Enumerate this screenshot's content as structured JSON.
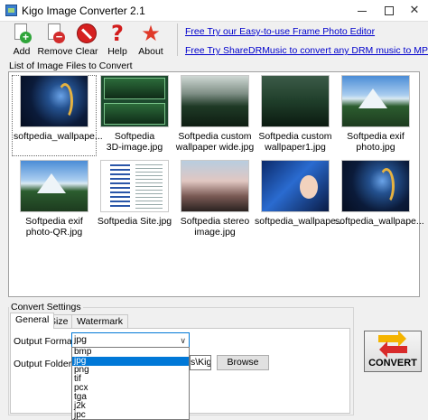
{
  "window": {
    "title": "Kigo Image Converter 2.1",
    "min": "",
    "max": "",
    "close": "✕"
  },
  "toolbar": {
    "add": "Add",
    "remove": "Remove",
    "clear": "Clear",
    "help": "Help",
    "about": "About",
    "help_glyph": "?",
    "about_glyph": "★"
  },
  "promos": {
    "link1": "Free Try our Easy-to-use Frame Photo Editor",
    "link2": "Free Try ShareDRMusic to convert any DRM music to MP3"
  },
  "image_list": {
    "label": "List of Image Files to Convert",
    "items": [
      {
        "caption": "softpedia_wallpape...",
        "icon": "dark-swirl"
      },
      {
        "caption": "Softpedia\n3D-image.jpg",
        "icon": "split-3d"
      },
      {
        "caption": "Softpedia custom\nwallpaper wide.jpg",
        "icon": "forest-fog"
      },
      {
        "caption": "Softpedia custom\nwallpaper1.jpg",
        "icon": "forest-dark"
      },
      {
        "caption": "Softpedia exif\nphoto.jpg",
        "icon": "mountain"
      },
      {
        "caption": "Softpedia exif\nphoto-QR.jpg",
        "icon": "mountain"
      },
      {
        "caption": "Softpedia Site.jpg",
        "icon": "website"
      },
      {
        "caption": "Softpedia stereo\nimage.jpg",
        "icon": "stereo"
      },
      {
        "caption": "softpedia_wallpape...",
        "icon": "girl"
      },
      {
        "caption": "softpedia_wallpape...",
        "icon": "dark-swirl"
      }
    ]
  },
  "settings": {
    "group_label": "Convert Settings",
    "tabs": [
      "General",
      "Size",
      "Watermark"
    ],
    "output_format_label": "Output Format",
    "output_format_value": "jpg",
    "output_folder_label": "Output Folder",
    "output_folder_value": "s\\Kig",
    "browse": "Browse",
    "format_options": [
      "bmp",
      "jpg",
      "png",
      "tif",
      "pcx",
      "tga",
      "j2k",
      "jpc"
    ],
    "selected_option": "jpg",
    "convert": "CONVERT"
  },
  "colors": {
    "selection": "#0078d7",
    "link": "#0000cc"
  }
}
